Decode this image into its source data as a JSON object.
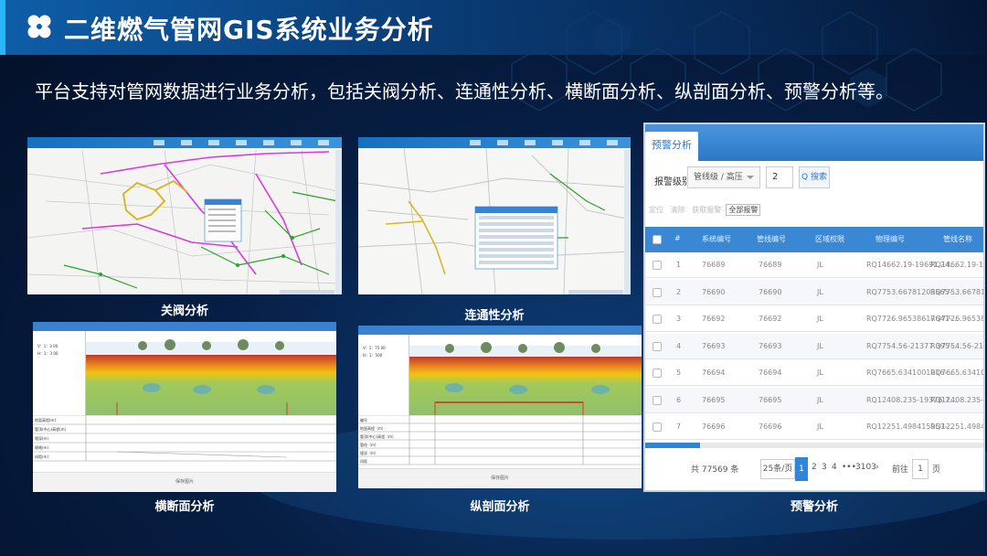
{
  "header": {
    "title": "二维燃气管网GIS系统业务分析",
    "subtitle": "平台支持对管网数据进行业务分析，包括关阀分析、连通性分析、横断面分析、纵剖面分析、预警分析等。"
  },
  "captions": {
    "valve": "关阀分析",
    "connectivity": "连通性分析",
    "cross_section": "横断面分析",
    "profile": "纵剖面分析",
    "warning": "预警分析"
  },
  "cross_section": {
    "params": [
      "V：1：3 00",
      "H：1：3 00"
    ],
    "rows": [
      "地面高程(m)",
      "管顶(中心)高程(m)",
      "埋深(m)",
      "规格(m)",
      "间距(m)"
    ],
    "footer": "保存图片"
  },
  "profile": {
    "params": [
      "V：1：75 00",
      "H：1：500"
    ],
    "rows": [
      "编号",
      "地面高程（m）",
      "管顶(中心)高程（m）",
      "管径（m）",
      "埋深（m）",
      "间距"
    ],
    "footer": "保存图片"
  },
  "warning": {
    "tab_label": "预警分析",
    "filter_label": "报警级别：",
    "filter_value": "管线级 / 高压",
    "filter_number": "2",
    "search_label": "Q 搜索",
    "toolbar": [
      "定位",
      "清除",
      "获取报警",
      "全部报警"
    ],
    "columns": [
      "#",
      "系统编号",
      "管线编号",
      "区域权限",
      "物理编号",
      "管线名称"
    ],
    "rows": [
      [
        "1",
        "76689",
        "76689",
        "JL",
        "RQ14662.19-19691.24...",
        "RQ14662.19-19691.24"
      ],
      [
        "2",
        "76690",
        "76690",
        "JL",
        "RQ7753.66781203565-...",
        "RQ7753.66781203565"
      ],
      [
        "3",
        "76692",
        "76692",
        "JL",
        "RQ7726.96538617641-...",
        "RQ7726.96538617641"
      ],
      [
        "4",
        "76693",
        "76693",
        "JL",
        "RQ7754.56-21377.395-...",
        "RQ7754.56-21377.39"
      ],
      [
        "5",
        "76694",
        "76694",
        "JL",
        "RQ7665.6341001016-...",
        "RQ7665.6341001016"
      ],
      [
        "6",
        "76695",
        "76695",
        "JL",
        "RQ12408.235-19376.7...",
        "RQ12408.235-19376"
      ],
      [
        "7",
        "76696",
        "76696",
        "JL",
        "RQ12251.498415957-...",
        "RQ12251.498415957"
      ]
    ],
    "pager": {
      "total": "共 77569 条",
      "page_size": "25条/页",
      "pages": [
        "1",
        "2",
        "3",
        "4",
        "•••",
        "3103"
      ],
      "goto_label": "前往",
      "goto_value": "1",
      "page_unit": "页"
    }
  },
  "colors": {
    "accent": "#29b6f6",
    "header_blue": "#2c78c8",
    "pipe_magenta": "#d63be0",
    "pipe_green": "#2da02d",
    "pipe_yellow": "#d6b72a"
  }
}
